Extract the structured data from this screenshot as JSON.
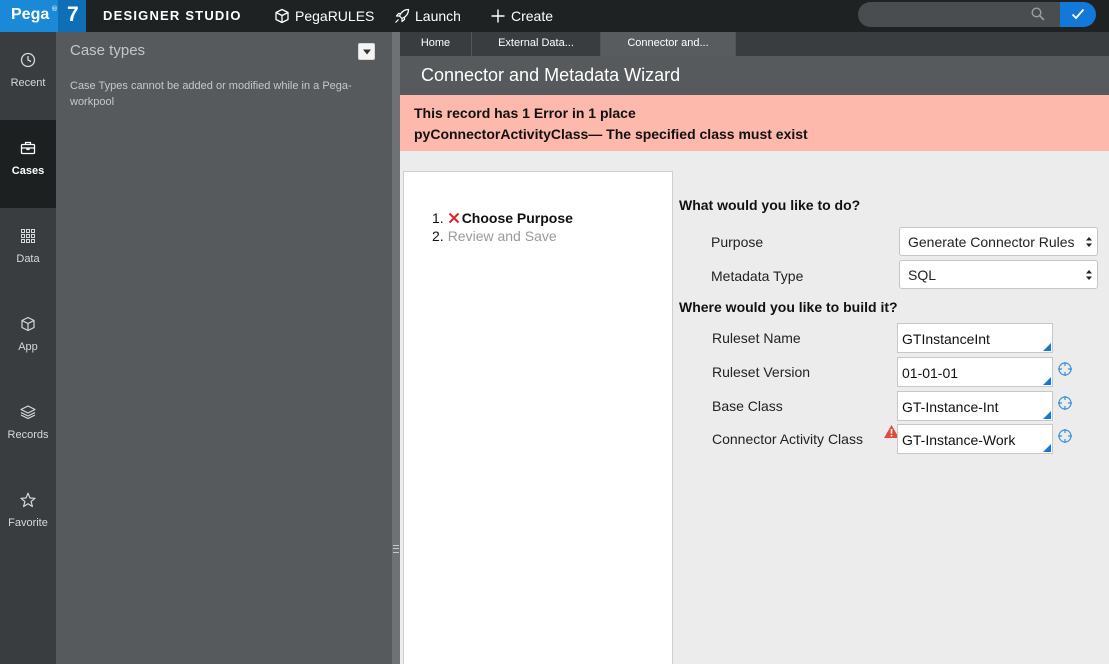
{
  "topbar": {
    "brand": "Pega",
    "brand_reg": "®",
    "brand_version": "7",
    "studio_name": "DESIGNER STUDIO",
    "nav": [
      {
        "label": "PegaRULES",
        "icon": "cube-icon"
      },
      {
        "label": "Launch",
        "icon": "rocket-icon"
      },
      {
        "label": "Create",
        "icon": "plus-icon"
      }
    ],
    "search_placeholder": ""
  },
  "leftnav": [
    {
      "label": "Recent",
      "icon": "clock-icon"
    },
    {
      "label": "Cases",
      "icon": "briefcase-icon",
      "active": true
    },
    {
      "label": "Data",
      "icon": "grid-icon"
    },
    {
      "label": "App",
      "icon": "cube-icon"
    },
    {
      "label": "Records",
      "icon": "layers-icon"
    },
    {
      "label": "Favorite",
      "icon": "star-icon"
    }
  ],
  "case_panel": {
    "title": "Case types",
    "note": "Case Types cannot be added or modified while in a Pega-workpool"
  },
  "tabs": [
    {
      "label": "Home"
    },
    {
      "label": "External Data..."
    },
    {
      "label": "Connector and...",
      "active": true
    }
  ],
  "header": {
    "title": "Connector and Metadata Wizard"
  },
  "error": {
    "line1": "This record has 1 Error in 1 place",
    "line2": "pyConnectorActivityClass— The specified class must exist",
    "color": "#fdb9ab"
  },
  "steps": [
    {
      "number": "1.",
      "label": "Choose Purpose",
      "status": "error"
    },
    {
      "number": "2.",
      "label": "Review and Save",
      "status": "pending"
    }
  ],
  "form": {
    "section1": "What would you like to do?",
    "section2": "Where would you like to build it?",
    "purpose": {
      "label": "Purpose",
      "value": "Generate Connector Rules"
    },
    "metadata_type": {
      "label": "Metadata Type",
      "value": "SQL"
    },
    "ruleset_name": {
      "label": "Ruleset Name",
      "value": "GTInstanceInt"
    },
    "ruleset_version": {
      "label": "Ruleset Version",
      "value": "01-01-01"
    },
    "base_class": {
      "label": "Base Class",
      "value": "GT-Instance-Int"
    },
    "connector_activity_class": {
      "label": "Connector Activity Class",
      "value": "GT-Instance-Work"
    }
  },
  "colors": {
    "accent": "#1478d8",
    "topbar": "#1f2223",
    "error_x": "#d9262c",
    "warning": "#e04b3a"
  }
}
